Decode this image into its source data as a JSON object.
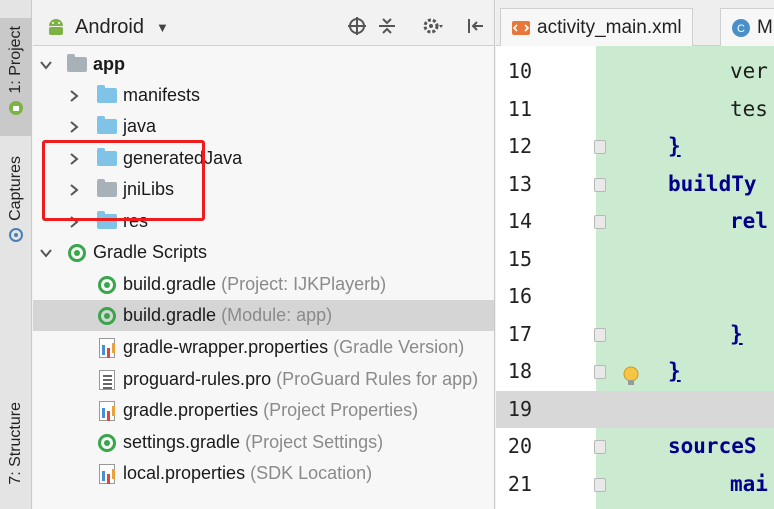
{
  "side_tabs": {
    "project": "1: Project",
    "captures": "Captures",
    "structure": "7: Structure"
  },
  "toolbar": {
    "view_mode": "Android"
  },
  "tree": {
    "items": [
      {
        "label": "app",
        "hint": ""
      },
      {
        "label": "manifests",
        "hint": ""
      },
      {
        "label": "java",
        "hint": ""
      },
      {
        "label": "generatedJava",
        "hint": ""
      },
      {
        "label": "jniLibs",
        "hint": ""
      },
      {
        "label": "res",
        "hint": ""
      },
      {
        "label": "Gradle Scripts",
        "hint": ""
      },
      {
        "label": "build.gradle",
        "hint": "(Project: IJKPlayerb)"
      },
      {
        "label": "build.gradle",
        "hint": "(Module: app)"
      },
      {
        "label": "gradle-wrapper.properties",
        "hint": "(Gradle Version)"
      },
      {
        "label": "proguard-rules.pro",
        "hint": "(ProGuard Rules for app)"
      },
      {
        "label": "gradle.properties",
        "hint": "(Project Properties)"
      },
      {
        "label": "settings.gradle",
        "hint": "(Project Settings)"
      },
      {
        "label": "local.properties",
        "hint": "(SDK Location)"
      }
    ]
  },
  "editor": {
    "tabs": [
      "activity_main.xml",
      "M"
    ],
    "lines": [
      {
        "num": "10",
        "text": "ver"
      },
      {
        "num": "11",
        "text": "tes"
      },
      {
        "num": "12",
        "text": "}"
      },
      {
        "num": "13",
        "text": "buildTy"
      },
      {
        "num": "14",
        "text": "rel"
      },
      {
        "num": "15",
        "text": ""
      },
      {
        "num": "16",
        "text": ""
      },
      {
        "num": "17",
        "text": "}"
      },
      {
        "num": "18",
        "text": "}"
      },
      {
        "num": "19",
        "text": ""
      },
      {
        "num": "20",
        "text": "sourceS"
      },
      {
        "num": "21",
        "text": "mai"
      }
    ]
  },
  "colors": {
    "highlight_box": "#ee1c1c",
    "code_background": "#cbebd0",
    "gradle_green": "#3aa64b",
    "folder_blue": "#7fc3e7"
  }
}
